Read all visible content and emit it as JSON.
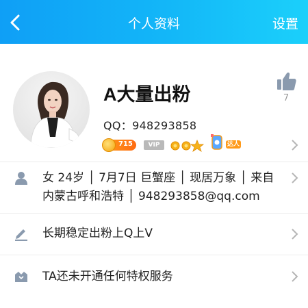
{
  "header": {
    "title": "个人资料",
    "settings_label": "设置",
    "accent_color": "#13b2f7"
  },
  "profile": {
    "nickname": "A大量出粉",
    "qq_line": "QQ：948293858",
    "level_badge": "715",
    "vip_badge": "VIP",
    "daren_badge": "达人",
    "like_count": "7"
  },
  "rows": [
    {
      "icon": "person-icon",
      "line1": "女  24岁 │ 7月7日  巨蟹座 │ 现居万象 │ 来自",
      "line2": "内蒙古呼和浩特 │ 948293858@qq.com"
    },
    {
      "icon": "pencil-icon",
      "text": "长期稳定出粉上Q上V"
    },
    {
      "icon": "crown-box-icon",
      "text": "TA还未开通任何特权服务"
    }
  ]
}
